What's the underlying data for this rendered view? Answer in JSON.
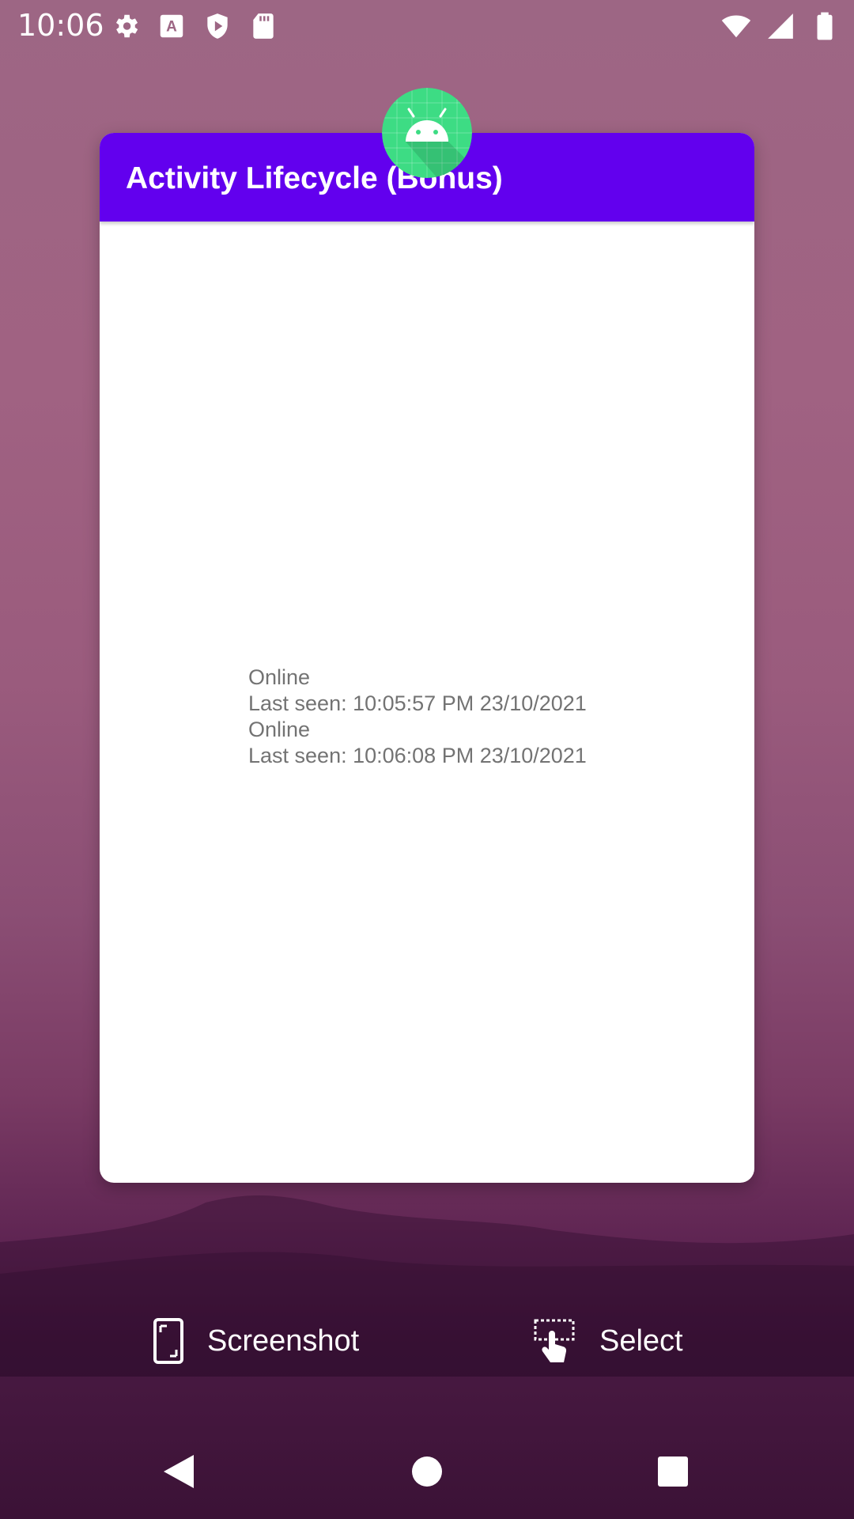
{
  "status_bar": {
    "time": "10:06",
    "left_icons": [
      "settings-icon",
      "font-icon",
      "shield-icon",
      "sd-card-icon"
    ],
    "right_icons": [
      "wifi-icon",
      "signal-icon",
      "battery-icon"
    ]
  },
  "app": {
    "title": "Activity Lifecycle (Bonus)",
    "accent_color": "#6200ee",
    "icon_color": "#3ddc84"
  },
  "log_lines": [
    "Online",
    "Last seen: 10:05:57 PM 23/10/2021",
    "Online",
    "Last seen: 10:06:08 PM 23/10/2021"
  ],
  "overview_actions": {
    "screenshot_label": "Screenshot",
    "select_label": "Select"
  },
  "nav": [
    "back-icon",
    "home-icon",
    "recents-icon"
  ]
}
